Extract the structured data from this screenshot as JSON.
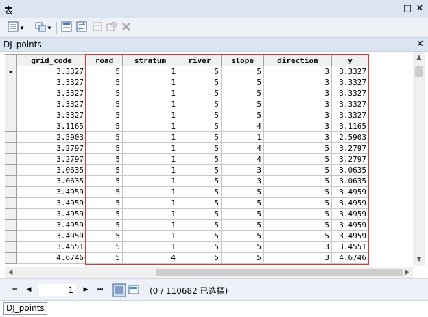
{
  "window": {
    "title": "表",
    "restore_glyph": "□",
    "close_glyph": "✕"
  },
  "toolbar": {
    "icons": [
      "table-options-icon",
      "related-tables-icon",
      "select-by-attributes-icon",
      "switch-selection-icon",
      "clear-selection-icon",
      "zoom-to-selected-icon",
      "delete-selected-icon"
    ]
  },
  "tab": {
    "name": "DJ_points",
    "close_glyph": "✕"
  },
  "grid": {
    "columns": [
      "grid_code",
      "road",
      "stratum",
      "river",
      "slope",
      "direction",
      "y"
    ],
    "current_row_marker": "▶",
    "rows": [
      [
        "3.3327",
        "5",
        "1",
        "5",
        "5",
        "3",
        "3.3327"
      ],
      [
        "3.3327",
        "5",
        "1",
        "5",
        "5",
        "3",
        "3.3327"
      ],
      [
        "3.3327",
        "5",
        "1",
        "5",
        "5",
        "3",
        "3.3327"
      ],
      [
        "3.3327",
        "5",
        "1",
        "5",
        "5",
        "3",
        "3.3327"
      ],
      [
        "3.3327",
        "5",
        "1",
        "5",
        "5",
        "3",
        "3.3327"
      ],
      [
        "3.1165",
        "5",
        "1",
        "5",
        "4",
        "3",
        "3.1165"
      ],
      [
        "2.5903",
        "5",
        "1",
        "5",
        "1",
        "3",
        "2.5903"
      ],
      [
        "3.2797",
        "5",
        "1",
        "5",
        "4",
        "5",
        "3.2797"
      ],
      [
        "3.2797",
        "5",
        "1",
        "5",
        "4",
        "5",
        "3.2797"
      ],
      [
        "3.0635",
        "5",
        "1",
        "5",
        "3",
        "5",
        "3.0635"
      ],
      [
        "3.0635",
        "5",
        "1",
        "5",
        "3",
        "5",
        "3.0635"
      ],
      [
        "3.4959",
        "5",
        "1",
        "5",
        "5",
        "5",
        "3.4959"
      ],
      [
        "3.4959",
        "5",
        "1",
        "5",
        "5",
        "5",
        "3.4959"
      ],
      [
        "3.4959",
        "5",
        "1",
        "5",
        "5",
        "5",
        "3.4959"
      ],
      [
        "3.4959",
        "5",
        "1",
        "5",
        "5",
        "5",
        "3.4959"
      ],
      [
        "3.4959",
        "5",
        "1",
        "5",
        "5",
        "5",
        "3.4959"
      ],
      [
        "3.4551",
        "5",
        "1",
        "5",
        "5",
        "3",
        "3.4551"
      ],
      [
        "4.6746",
        "5",
        "4",
        "5",
        "5",
        "3",
        "4.6746"
      ]
    ]
  },
  "navigation": {
    "first_glyph": "⏮",
    "prev_glyph": "◀",
    "next_glyph": "▶",
    "last_glyph": "⏭",
    "current_page": "1",
    "status": "(0 / 110682 已选择)"
  },
  "bottom_tab": {
    "label": "DJ_points"
  },
  "colors": {
    "highlight_border": "#d03b3b",
    "titlebar_bg": "#dbe4f1",
    "toolbar_bg": "#eef2f8"
  }
}
